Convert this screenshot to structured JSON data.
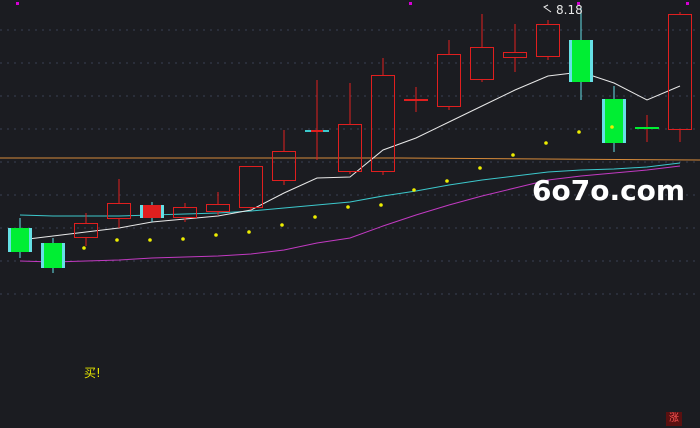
{
  "labels": {
    "high_label": "8.18",
    "buy_label": "买!",
    "watermark": "6o7o.com",
    "corner_badge": "涨"
  },
  "colors": {
    "background": "#1b1c21",
    "grid": "#3a3f52",
    "up": "#e01f1f",
    "down_body": "#00ee33",
    "down_edge": "#66e0e6",
    "doji": "#e01f1f",
    "ma_white": "#e8e8e8",
    "ma_orange": "#d68a3a",
    "ma_cyan": "#3cc8cc",
    "ma_magenta": "#c23ac2",
    "dots": "#eded00",
    "label_white": "#e8e8e8",
    "label_yellow": "#e6e600",
    "badge_text": "#ff5555",
    "marker_magenta": "#d400d4"
  },
  "chart_data": {
    "type": "candlestick",
    "ylim": [
      0,
      428
    ],
    "candles": [
      {
        "o": 228,
        "c": 252,
        "h": 218,
        "l": 258
      },
      {
        "o": 243,
        "c": 268,
        "h": 238,
        "l": 273
      },
      {
        "o": 238,
        "c": 223,
        "h": 213,
        "l": 246
      },
      {
        "o": 219,
        "c": 203,
        "h": 179,
        "l": 228
      },
      {
        "o": 205,
        "c": 218,
        "h": 202,
        "l": 222
      },
      {
        "o": 218,
        "c": 207,
        "h": 203,
        "l": 222
      },
      {
        "o": 212,
        "c": 204,
        "h": 192,
        "l": 215
      },
      {
        "o": 208,
        "c": 166,
        "h": 166,
        "l": 210
      },
      {
        "o": 181,
        "c": 151,
        "h": 130,
        "l": 185
      },
      {
        "o": 131,
        "c": 131,
        "h": 80,
        "l": 160
      },
      {
        "o": 172,
        "c": 124,
        "h": 83,
        "l": 174
      },
      {
        "o": 172,
        "c": 75,
        "h": 58,
        "l": 175
      },
      {
        "o": 100,
        "c": 100,
        "h": 87,
        "l": 112
      },
      {
        "o": 107,
        "c": 54,
        "h": 40,
        "l": 110
      },
      {
        "o": 80,
        "c": 47,
        "h": 14,
        "l": 82
      },
      {
        "o": 58,
        "c": 52,
        "h": 24,
        "l": 72
      },
      {
        "o": 57,
        "c": 24,
        "h": 20,
        "l": 60
      },
      {
        "o": 40,
        "c": 82,
        "h": 8,
        "l": 100
      },
      {
        "o": 99,
        "c": 143,
        "h": 86,
        "l": 152
      },
      {
        "o": 128,
        "c": 128,
        "h": 115,
        "l": 142
      },
      {
        "o": 130,
        "c": 14,
        "h": 12,
        "l": 142
      }
    ],
    "ma_white": [
      240,
      236,
      232,
      228,
      222,
      219,
      216,
      210,
      193,
      178,
      177,
      150,
      138,
      122,
      106,
      90,
      76,
      72,
      83,
      100,
      86
    ],
    "ma_orange_y": [
      158,
      158,
      160
    ],
    "ma_cyan": [
      215,
      216,
      216,
      216,
      215,
      214,
      213,
      211,
      208,
      205,
      202,
      196,
      191,
      185,
      180,
      176,
      172,
      170,
      169,
      167,
      163
    ],
    "ma_magenta": [
      261,
      262,
      261,
      260,
      258,
      257,
      256,
      254,
      250,
      243,
      238,
      226,
      215,
      205,
      196,
      188,
      180,
      176,
      173,
      170,
      166
    ],
    "dots": [
      null,
      248,
      240,
      240,
      239,
      235,
      232,
      225,
      217,
      207,
      205,
      190,
      181,
      168,
      155,
      143,
      132,
      127,
      null,
      null,
      null
    ]
  }
}
